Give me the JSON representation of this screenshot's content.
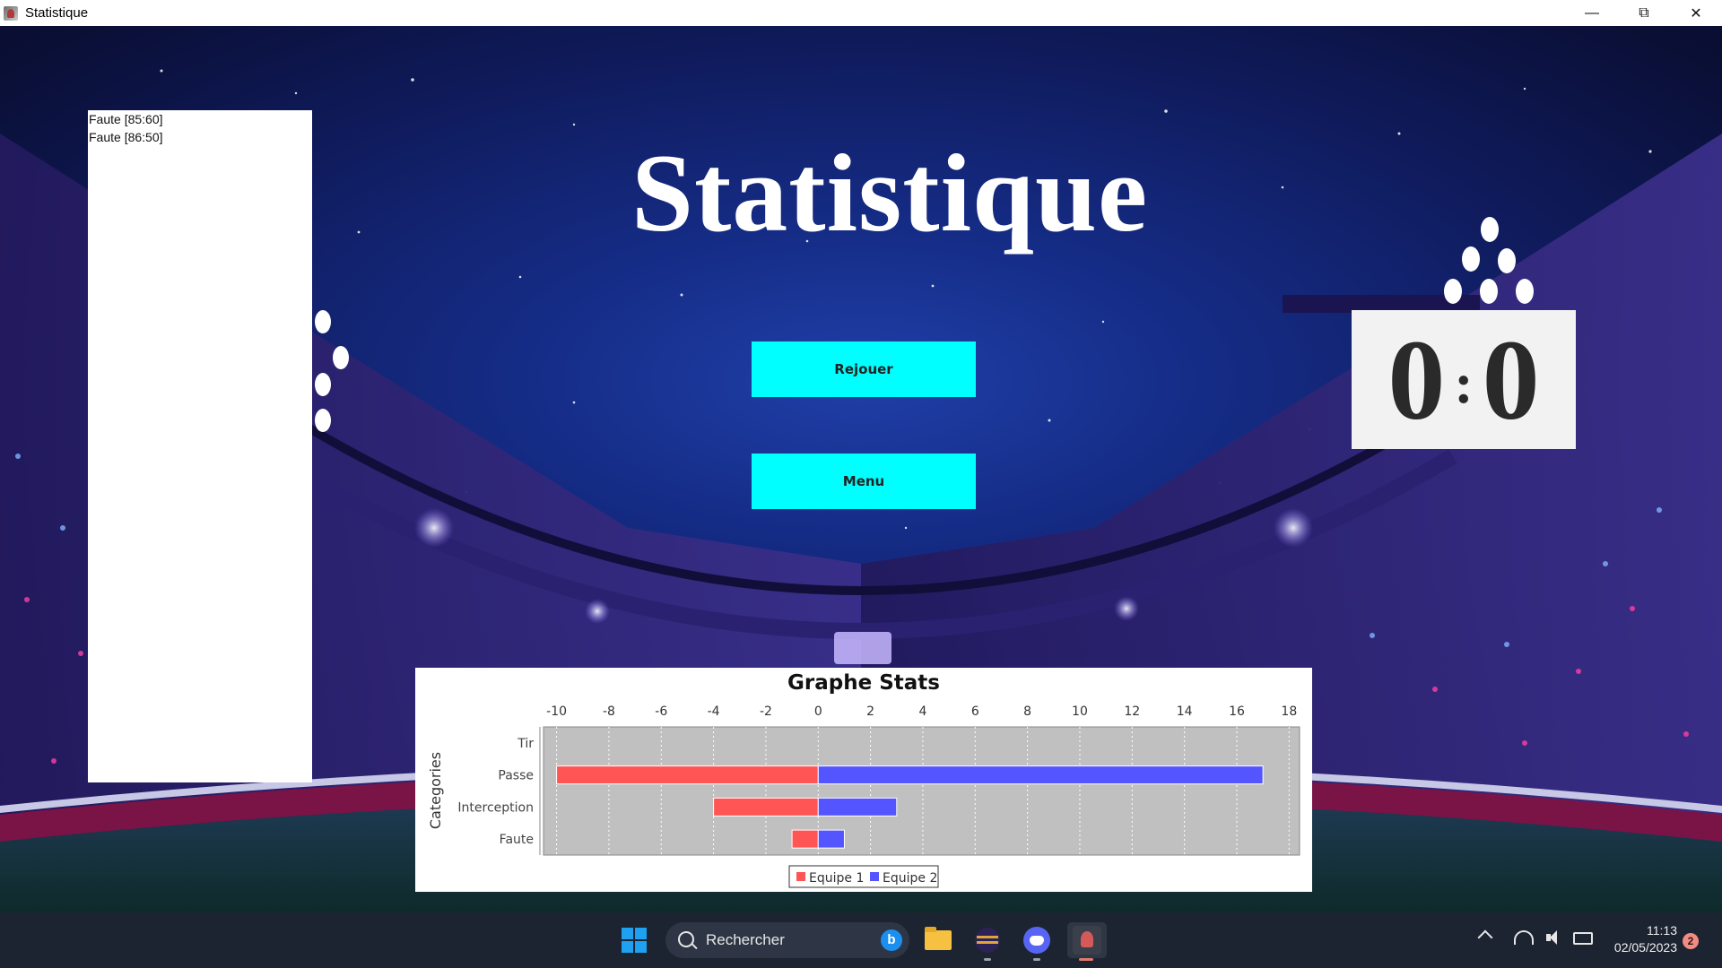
{
  "window": {
    "title": "Statistique",
    "controls": [
      "minimize",
      "restore",
      "close"
    ]
  },
  "colors": {
    "button": "#00ffff",
    "equipe1": "#ff5555",
    "equipe2": "#5555ff",
    "plot_bg": "#c0c0c0"
  },
  "log": {
    "lines": [
      "Faute [85:60]",
      "Faute [86:50]"
    ]
  },
  "page_title": "Statistique",
  "buttons": {
    "rejouer": "Rejouer",
    "menu": "Menu"
  },
  "score": {
    "team1": "0",
    "separator": ":",
    "team2": "0"
  },
  "chart_data": {
    "type": "bar",
    "orientation": "horizontal",
    "title": "Graphe Stats",
    "ylabel": "Categories",
    "categories": [
      "Tir",
      "Passe",
      "Interception",
      "Faute"
    ],
    "series": [
      {
        "name": "Equipe 1",
        "values": [
          0,
          -10,
          -4,
          -1
        ]
      },
      {
        "name": "Equipe 2",
        "values": [
          0,
          17,
          3,
          1
        ]
      }
    ],
    "xlim": [
      -10.5,
      18.4
    ],
    "xticks": [
      -10,
      -8,
      -6,
      -4,
      -2,
      0,
      2,
      4,
      6,
      8,
      10,
      12,
      14,
      16,
      18
    ],
    "grid": true,
    "legend_position": "bottom"
  },
  "taskbar": {
    "search_placeholder": "Rechercher",
    "apps": [
      "file-explorer",
      "eclipse",
      "discord",
      "java-app"
    ],
    "time": "11:13",
    "date": "02/05/2023",
    "notification_count": "2"
  }
}
